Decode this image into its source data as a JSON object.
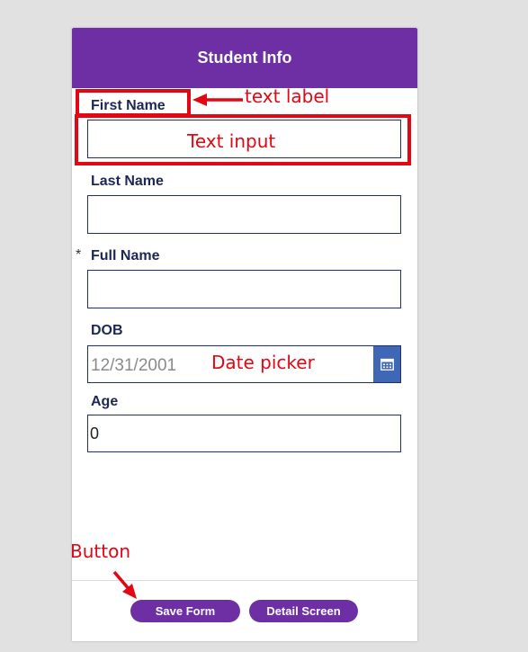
{
  "header": {
    "title": "Student Info"
  },
  "form": {
    "first_name": {
      "label": "First Name",
      "value": ""
    },
    "last_name": {
      "label": "Last Name",
      "value": ""
    },
    "full_name": {
      "label": "Full Name",
      "value": "",
      "required_marker": "*"
    },
    "dob": {
      "label": "DOB",
      "value": "12/31/2001",
      "icon": "calendar-icon"
    },
    "age": {
      "label": "Age",
      "value": "0"
    }
  },
  "buttons": {
    "save": "Save Form",
    "detail": "Detail Screen"
  },
  "annotations": {
    "text_label": "text label",
    "text_input": "Text input",
    "date_picker": "Date picker",
    "button": "Button"
  },
  "colors": {
    "header_bg": "#6d2fa3",
    "button_bg": "#6d2fa3",
    "label_text": "#1d2754",
    "input_border": "#1f2f6e",
    "calendar_bg": "#3f67b6",
    "annotation_red": "#e30613"
  }
}
